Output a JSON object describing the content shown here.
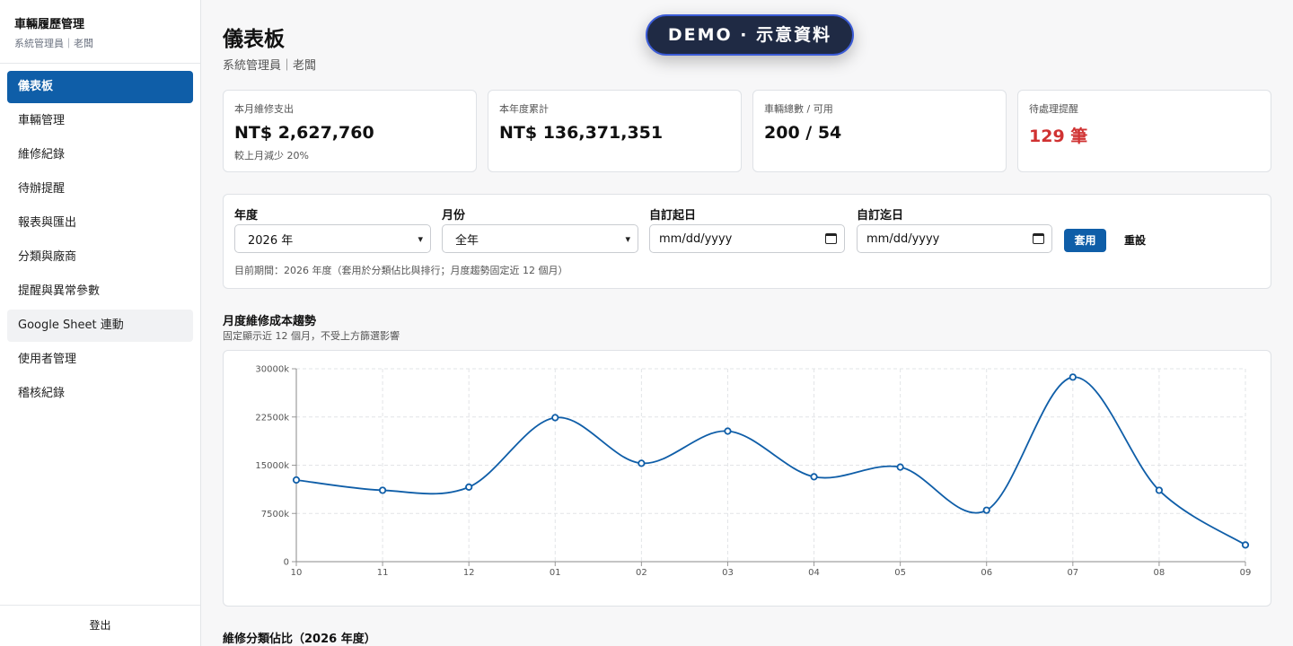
{
  "sidebar": {
    "title": "車輛履歷管理",
    "subtitle": "系統管理員｜老闆",
    "items": [
      {
        "label": "儀表板"
      },
      {
        "label": "車輛管理"
      },
      {
        "label": "維修紀錄"
      },
      {
        "label": "待辦提醒"
      },
      {
        "label": "報表與匯出"
      },
      {
        "label": "分類與廠商"
      },
      {
        "label": "提醒與異常參數"
      },
      {
        "label": "Google Sheet 連動"
      },
      {
        "label": "使用者管理"
      },
      {
        "label": "稽核紀錄"
      }
    ],
    "active_index": 0,
    "hover_index": 7,
    "logout": "登出"
  },
  "header": {
    "title": "儀表板",
    "subtitle": "系統管理員｜老闆",
    "demo_badge": "DEMO · 示意資料"
  },
  "kpis": [
    {
      "label": "本月維修支出",
      "value": "NT$ 2,627,760",
      "note": "較上月減少 20%"
    },
    {
      "label": "本年度累計",
      "value": "NT$ 136,371,351",
      "note": ""
    },
    {
      "label": "車輛總數 / 可用",
      "value": "200 / 54",
      "note": ""
    },
    {
      "label": "待處理提醒",
      "value": "129 筆",
      "note": ""
    }
  ],
  "filters": {
    "year_label": "年度",
    "year_value": "2026 年",
    "month_label": "月份",
    "month_value": "全年",
    "start_label": "自訂起日",
    "start_placeholder": "mm/dd/yyyy",
    "end_label": "自訂迄日",
    "end_placeholder": "mm/dd/yyyy",
    "apply": "套用",
    "reset": "重設",
    "note": "目前期間：2026 年度（套用於分類佔比與排行；月度趨勢固定近 12 個月）"
  },
  "trend_section": {
    "title": "月度維修成本趨勢",
    "subtitle": "固定顯示近 12 個月，不受上方篩選影響"
  },
  "category_section": {
    "title": "維修分類佔比（2026 年度）"
  },
  "chart_data": {
    "type": "line",
    "categories": [
      "10",
      "11",
      "12",
      "01",
      "02",
      "03",
      "04",
      "05",
      "06",
      "07",
      "08",
      "09"
    ],
    "series": [
      {
        "values": [
          12700,
          11100,
          11600,
          22400,
          15300,
          20300,
          13200,
          14700,
          8000,
          28700,
          11100,
          2600
        ]
      }
    ],
    "ylim": [
      0,
      30000
    ],
    "yticks": [
      "0",
      "7500k",
      "15000k",
      "22500k",
      "30000k"
    ],
    "grid": true,
    "color": "#0f5ea8"
  },
  "colors": {
    "accent": "#0f5ea8",
    "alert": "#d03232",
    "badge_bg": "#1f2a44"
  }
}
